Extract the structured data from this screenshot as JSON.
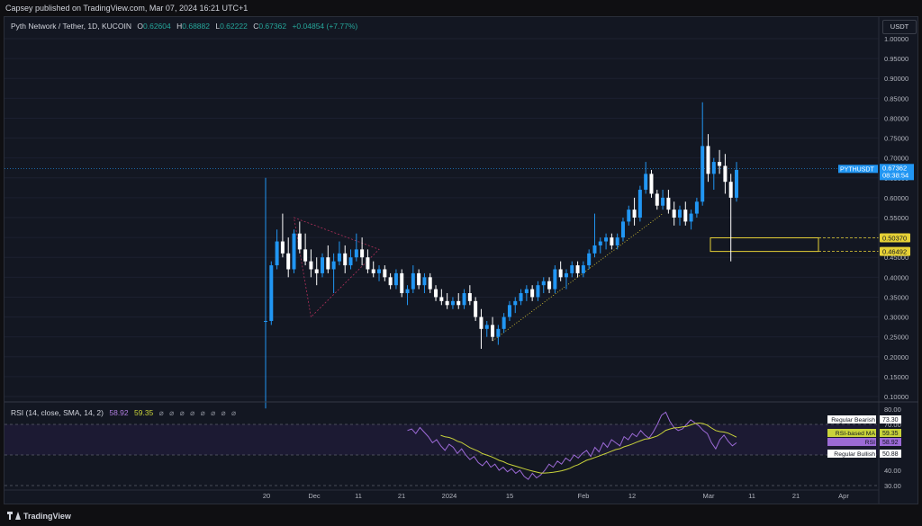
{
  "header": {
    "published": "Capsey published on TradingView.com, Mar 07, 2024 16:21 UTC+1"
  },
  "symbol": {
    "name": "Pyth Network / Tether, 1D, KUCOIN",
    "o_label": "O",
    "open": "0.62604",
    "h_label": "H",
    "high": "0.68882",
    "l_label": "L",
    "low": "0.62222",
    "c_label": "C",
    "close": "0.67362",
    "change": "+0.04854 (+7.77%)"
  },
  "currency": "USDT",
  "price_scale": [
    "1.00000",
    "0.95000",
    "0.90000",
    "0.85000",
    "0.80000",
    "0.75000",
    "0.70000",
    "0.65000",
    "0.60000",
    "0.55000",
    "0.50000",
    "0.45000",
    "0.40000",
    "0.35000",
    "0.30000",
    "0.25000",
    "0.20000",
    "0.15000",
    "0.10000"
  ],
  "price_tag": {
    "ticker": "PYTHUSDT",
    "price": "0.67362",
    "countdown": "08:38:54"
  },
  "levels": {
    "upper": "0.50370",
    "lower": "0.46492"
  },
  "rsi": {
    "legend": "RSI (14, close, SMA, 14, 2)",
    "value": "58.92",
    "ma_value": "59.35",
    "symbols": "⌀ ⌀ ⌀ ⌀ ⌀ ⌀ ⌀ ⌀",
    "scale": [
      "80.00",
      "70.00",
      "60.00",
      "50.00",
      "40.00",
      "30.00"
    ],
    "tags": [
      {
        "label": "Regular Bearish",
        "value": "73.30"
      },
      {
        "label": "RSI-based MA",
        "value": "59.35"
      },
      {
        "label": "RSI",
        "value": "58.92"
      },
      {
        "label": "Regular Bullish",
        "value": "50.88"
      }
    ]
  },
  "time_axis": [
    "20",
    "Dec",
    "11",
    "21",
    "2024",
    "15",
    "Feb",
    "12",
    "Mar",
    "11",
    "21",
    "Apr"
  ],
  "colors": {
    "up": "#2196f3",
    "down": "#ffffff",
    "rsi": "#9c6ad6",
    "rsi_ma": "#c9d33a",
    "level_box": "#e6d136",
    "pyth_tag": "#2196f3"
  },
  "footer": {
    "brand": "TradingView"
  },
  "candles": [
    [
      0.29,
      0.65,
      0.07,
      0.29
    ],
    [
      0.29,
      0.44,
      0.28,
      0.43
    ],
    [
      0.43,
      0.52,
      0.42,
      0.49
    ],
    [
      0.49,
      0.56,
      0.45,
      0.46
    ],
    [
      0.46,
      0.5,
      0.4,
      0.42
    ],
    [
      0.42,
      0.52,
      0.41,
      0.51
    ],
    [
      0.51,
      0.54,
      0.46,
      0.47
    ],
    [
      0.47,
      0.51,
      0.43,
      0.44
    ],
    [
      0.44,
      0.47,
      0.4,
      0.42
    ],
    [
      0.42,
      0.45,
      0.38,
      0.41
    ],
    [
      0.41,
      0.46,
      0.4,
      0.45
    ],
    [
      0.45,
      0.48,
      0.41,
      0.42
    ],
    [
      0.42,
      0.46,
      0.36,
      0.44
    ],
    [
      0.44,
      0.49,
      0.43,
      0.46
    ],
    [
      0.46,
      0.48,
      0.41,
      0.43
    ],
    [
      0.43,
      0.47,
      0.42,
      0.45
    ],
    [
      0.45,
      0.51,
      0.44,
      0.47
    ],
    [
      0.47,
      0.5,
      0.43,
      0.45
    ],
    [
      0.45,
      0.47,
      0.41,
      0.42
    ],
    [
      0.42,
      0.44,
      0.4,
      0.41
    ],
    [
      0.41,
      0.43,
      0.39,
      0.42
    ],
    [
      0.42,
      0.43,
      0.39,
      0.4
    ],
    [
      0.4,
      0.41,
      0.37,
      0.38
    ],
    [
      0.38,
      0.42,
      0.37,
      0.41
    ],
    [
      0.41,
      0.42,
      0.35,
      0.36
    ],
    [
      0.36,
      0.38,
      0.33,
      0.37
    ],
    [
      0.37,
      0.43,
      0.36,
      0.41
    ],
    [
      0.41,
      0.42,
      0.37,
      0.38
    ],
    [
      0.38,
      0.41,
      0.36,
      0.4
    ],
    [
      0.4,
      0.41,
      0.36,
      0.37
    ],
    [
      0.37,
      0.38,
      0.34,
      0.35
    ],
    [
      0.35,
      0.37,
      0.33,
      0.34
    ],
    [
      0.34,
      0.36,
      0.32,
      0.33
    ],
    [
      0.33,
      0.35,
      0.32,
      0.34
    ],
    [
      0.34,
      0.36,
      0.32,
      0.33
    ],
    [
      0.33,
      0.37,
      0.32,
      0.36
    ],
    [
      0.36,
      0.38,
      0.33,
      0.34
    ],
    [
      0.34,
      0.35,
      0.29,
      0.3
    ],
    [
      0.3,
      0.32,
      0.22,
      0.27
    ],
    [
      0.27,
      0.29,
      0.25,
      0.28
    ],
    [
      0.28,
      0.3,
      0.24,
      0.25
    ],
    [
      0.25,
      0.28,
      0.23,
      0.27
    ],
    [
      0.27,
      0.31,
      0.26,
      0.3
    ],
    [
      0.3,
      0.34,
      0.29,
      0.33
    ],
    [
      0.33,
      0.35,
      0.31,
      0.34
    ],
    [
      0.34,
      0.37,
      0.33,
      0.36
    ],
    [
      0.36,
      0.38,
      0.34,
      0.37
    ],
    [
      0.37,
      0.38,
      0.34,
      0.35
    ],
    [
      0.35,
      0.39,
      0.34,
      0.38
    ],
    [
      0.38,
      0.4,
      0.36,
      0.39
    ],
    [
      0.39,
      0.4,
      0.36,
      0.37
    ],
    [
      0.37,
      0.43,
      0.36,
      0.42
    ],
    [
      0.42,
      0.44,
      0.39,
      0.4
    ],
    [
      0.4,
      0.42,
      0.37,
      0.41
    ],
    [
      0.41,
      0.44,
      0.4,
      0.43
    ],
    [
      0.43,
      0.44,
      0.4,
      0.41
    ],
    [
      0.41,
      0.44,
      0.4,
      0.43
    ],
    [
      0.43,
      0.47,
      0.42,
      0.46
    ],
    [
      0.46,
      0.56,
      0.45,
      0.48
    ],
    [
      0.48,
      0.5,
      0.46,
      0.49
    ],
    [
      0.49,
      0.51,
      0.47,
      0.5
    ],
    [
      0.5,
      0.51,
      0.47,
      0.48
    ],
    [
      0.48,
      0.51,
      0.47,
      0.5
    ],
    [
      0.5,
      0.55,
      0.49,
      0.54
    ],
    [
      0.54,
      0.58,
      0.53,
      0.57
    ],
    [
      0.57,
      0.6,
      0.53,
      0.55
    ],
    [
      0.55,
      0.63,
      0.54,
      0.62
    ],
    [
      0.62,
      0.69,
      0.61,
      0.66
    ],
    [
      0.66,
      0.67,
      0.6,
      0.61
    ],
    [
      0.61,
      0.62,
      0.57,
      0.58
    ],
    [
      0.58,
      0.62,
      0.57,
      0.6
    ],
    [
      0.6,
      0.62,
      0.56,
      0.57
    ],
    [
      0.57,
      0.59,
      0.53,
      0.55
    ],
    [
      0.55,
      0.58,
      0.53,
      0.57
    ],
    [
      0.57,
      0.59,
      0.53,
      0.54
    ],
    [
      0.54,
      0.57,
      0.52,
      0.56
    ],
    [
      0.56,
      0.6,
      0.55,
      0.59
    ],
    [
      0.59,
      0.84,
      0.58,
      0.73
    ],
    [
      0.73,
      0.76,
      0.64,
      0.66
    ],
    [
      0.66,
      0.7,
      0.62,
      0.69
    ],
    [
      0.69,
      0.72,
      0.66,
      0.68
    ],
    [
      0.68,
      0.71,
      0.61,
      0.64
    ],
    [
      0.64,
      0.66,
      0.44,
      0.6
    ],
    [
      0.6,
      0.69,
      0.59,
      0.67
    ]
  ],
  "rsi_series": [
    66,
    67,
    64,
    68,
    65,
    62,
    58,
    60,
    56,
    53,
    57,
    55,
    51,
    54,
    50,
    47,
    49,
    45,
    43,
    46,
    42,
    44,
    40,
    42,
    39,
    41,
    38,
    40,
    36,
    34,
    38,
    35,
    37,
    40,
    44,
    42,
    46,
    44,
    48,
    46,
    50,
    48,
    51,
    53,
    49,
    55,
    52,
    58,
    55,
    60,
    58,
    56,
    62,
    60,
    64,
    62,
    66,
    63,
    61,
    65,
    70,
    76,
    78,
    72,
    68,
    66,
    67,
    70,
    73,
    71,
    69,
    66,
    64,
    58,
    54,
    60,
    63,
    59,
    56,
    58
  ]
}
